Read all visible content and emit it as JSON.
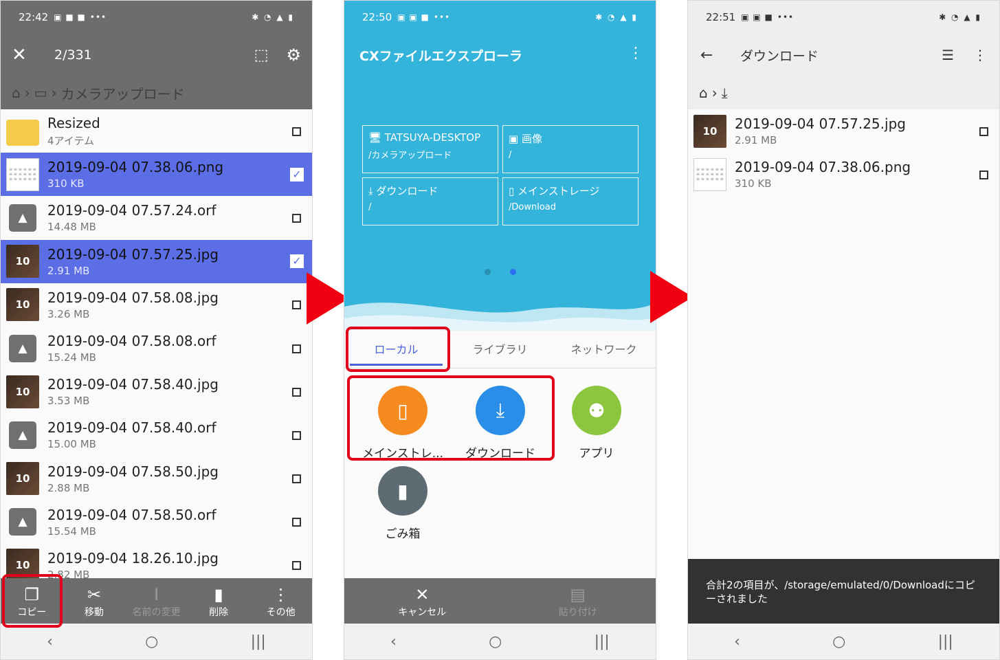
{
  "status": {
    "p1_time": "22:42",
    "p2_time": "22:50",
    "p3_time": "22:51",
    "glyphs": "•••"
  },
  "nav": {
    "back": "‹",
    "home": "○",
    "recent": "|||"
  },
  "p1": {
    "counter": "2/331",
    "crumb": "カメラアップロード",
    "files": [
      {
        "name": "Resized",
        "size": "4アイテム",
        "kind": "folder",
        "selected": false
      },
      {
        "name": "2019-09-04 07.38.06.png",
        "size": "310 KB",
        "kind": "doc",
        "selected": true
      },
      {
        "name": "2019-09-04 07.57.24.orf",
        "size": "14.48 MB",
        "kind": "generic",
        "selected": false
      },
      {
        "name": "2019-09-04 07.57.25.jpg",
        "size": "2.91 MB",
        "kind": "photo",
        "selected": true
      },
      {
        "name": "2019-09-04 07.58.08.jpg",
        "size": "3.26 MB",
        "kind": "photo",
        "selected": false
      },
      {
        "name": "2019-09-04 07.58.08.orf",
        "size": "15.24 MB",
        "kind": "generic",
        "selected": false
      },
      {
        "name": "2019-09-04 07.58.40.jpg",
        "size": "3.53 MB",
        "kind": "photo",
        "selected": false
      },
      {
        "name": "2019-09-04 07.58.40.orf",
        "size": "15.00 MB",
        "kind": "generic",
        "selected": false
      },
      {
        "name": "2019-09-04 07.58.50.jpg",
        "size": "2.88 MB",
        "kind": "photo",
        "selected": false
      },
      {
        "name": "2019-09-04 07.58.50.orf",
        "size": "15.54 MB",
        "kind": "generic",
        "selected": false
      },
      {
        "name": "2019-09-04 18.26.10.jpg",
        "size": "2.82 MB",
        "kind": "photo",
        "selected": false
      }
    ],
    "actions": [
      {
        "label": "コピー",
        "icon": "❐",
        "name": "copy-button",
        "disabled": false
      },
      {
        "label": "移動",
        "icon": "✂",
        "name": "move-button",
        "disabled": false
      },
      {
        "label": "名前の変更",
        "icon": "I",
        "name": "rename-button",
        "disabled": true
      },
      {
        "label": "削除",
        "icon": "▮",
        "name": "delete-button",
        "disabled": false
      },
      {
        "label": "その他",
        "icon": "⋮",
        "name": "more-button",
        "disabled": false
      }
    ]
  },
  "p2": {
    "app_title": "CXファイルエクスプローラ",
    "tiles": [
      {
        "title": "🖥 TATSUYA-DESKTOP",
        "path": "/カメラアップロード"
      },
      {
        "title": "▣ 画像",
        "path": "/"
      },
      {
        "title": "⤓ ダウンロード",
        "path": "/"
      },
      {
        "title": "▯ メインストレージ",
        "path": "/Download"
      }
    ],
    "tabs": [
      "ローカル",
      "ライブラリ",
      "ネットワーク"
    ],
    "shortcuts": [
      {
        "label": "メインストレ...",
        "color": "#f58a1f",
        "icon": "▯"
      },
      {
        "label": "ダウンロード",
        "color": "#2a8ee8",
        "icon": "⤓"
      },
      {
        "label": "アプリ",
        "color": "#8cc63f",
        "icon": "⚉"
      },
      {
        "label": "ごみ箱",
        "color": "#5f6b73",
        "icon": "▮"
      }
    ],
    "cancel_label": "キャンセル",
    "paste_label": "貼り付け"
  },
  "p3": {
    "title": "ダウンロード",
    "files": [
      {
        "name": "2019-09-04 07.57.25.jpg",
        "size": "2.91 MB",
        "kind": "photo"
      },
      {
        "name": "2019-09-04 07.38.06.png",
        "size": "310 KB",
        "kind": "doc"
      }
    ],
    "snackbar": "合計2の項目が、/storage/emulated/0/Downloadにコピーされました"
  },
  "colors": {
    "selected": "#5b6ee6",
    "hero": "#34b4db",
    "annotation": "#e0001b"
  }
}
